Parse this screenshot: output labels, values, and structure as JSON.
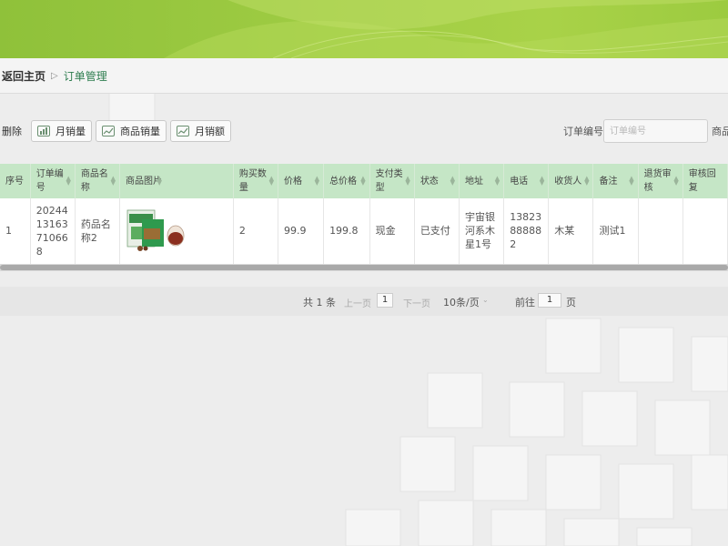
{
  "breadcrumb": {
    "home": "返回主页",
    "separator": "▷",
    "current": "订单管理"
  },
  "toolbar": {
    "delete_label": "删除",
    "buttons": [
      {
        "label": "月销量",
        "icon": "bar-chart-icon"
      },
      {
        "label": "商品销量",
        "icon": "line-chart-icon"
      },
      {
        "label": "月销额",
        "icon": "line-chart-icon"
      }
    ],
    "search_label": "订单编号",
    "search_placeholder": "订单编号",
    "search_label2": "商品"
  },
  "table": {
    "columns": [
      "序号",
      "订单编号",
      "商品名称",
      "商品图片",
      "购买数量",
      "价格",
      "总价格",
      "支付类型",
      "状态",
      "地址",
      "电话",
      "收货人",
      "备注",
      "退货审核",
      "审核回复"
    ],
    "rows": [
      [
        "1",
        "20244131637​10668",
        "药品名称2",
        "",
        "2",
        "99.9",
        "199.8",
        "现金",
        "已支付",
        "宇宙银河系木星1号",
        "13823888882",
        "木某",
        "测试1",
        "",
        ""
      ]
    ]
  },
  "pager": {
    "total": "共 1 条",
    "prev": "上一页",
    "page": "1",
    "next": "下一页",
    "page_size": "10条/页",
    "goto_label": "前往",
    "goto_value": "1",
    "goto_unit": "页"
  },
  "colors": {
    "banner": "#9fcc43",
    "header": "#c5e6c6",
    "accent": "#2e7d4f"
  }
}
